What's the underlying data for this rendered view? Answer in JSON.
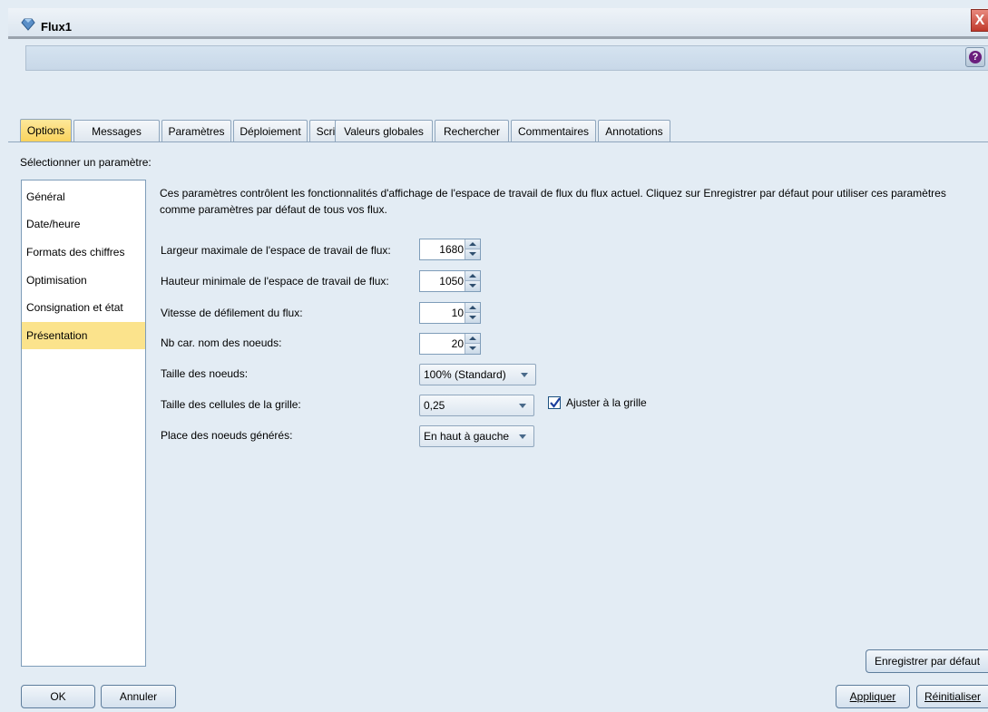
{
  "window": {
    "title": "Flux1",
    "close_glyph": "X",
    "help_glyph": "?"
  },
  "tabs": [
    {
      "label": "Options",
      "active": true
    },
    {
      "label": "Messages"
    },
    {
      "label": "Paramètres"
    },
    {
      "label": "Déploiement"
    },
    {
      "label": "Script"
    },
    {
      "label": "Valeurs globales"
    },
    {
      "label": "Rechercher"
    },
    {
      "label": "Commentaires"
    },
    {
      "label": "Annotations"
    }
  ],
  "select_label": "Sélectionner un paramètre:",
  "sidebar": {
    "items": [
      {
        "label": "Général"
      },
      {
        "label": "Date/heure"
      },
      {
        "label": "Formats des chiffres"
      },
      {
        "label": "Optimisation"
      },
      {
        "label": "Consignation et état"
      },
      {
        "label": "Présentation",
        "selected": true
      }
    ]
  },
  "description": "Ces paramètres contrôlent les fonctionnalités d'affichage de l'espace de travail de flux du  flux actuel. Cliquez sur Enregistrer par défaut pour utiliser ces paramètres comme paramètres par défaut de tous vos flux.",
  "settings": {
    "max_width": {
      "label": "Largeur maximale de l'espace de travail de flux:",
      "value": "1680"
    },
    "min_height": {
      "label": "Hauteur minimale de l'espace de travail de flux:",
      "value": "1050"
    },
    "scroll_speed": {
      "label": "Vitesse de défilement du flux:",
      "value": "10"
    },
    "node_name_chars": {
      "label": "Nb car. nom des noeuds:",
      "value": "20"
    },
    "node_size": {
      "label": "Taille des noeuds:",
      "value": "100% (Standard)"
    },
    "grid_cell_size": {
      "label": "Taille des cellules de la grille:",
      "value": "0,25"
    },
    "snap_to_grid": {
      "label": "Ajuster à la grille",
      "checked": true
    },
    "generated_nodes_place": {
      "label": "Place des noeuds générés:",
      "value": "En haut à gauche"
    }
  },
  "buttons": {
    "save_default": "Enregistrer par défaut",
    "ok": "OK",
    "cancel": "Annuler",
    "apply": "Appliquer",
    "reset": "Réinitialiser"
  },
  "icons": {
    "title": "stream-diamond-icon",
    "help": "help-icon",
    "close": "close-icon",
    "check": "checkmark-icon"
  },
  "colors": {
    "selected_tab": "#f9d25a",
    "selected_item": "#fbe38c",
    "window_bg": "#e3ecf4",
    "close": "#c0392b"
  }
}
